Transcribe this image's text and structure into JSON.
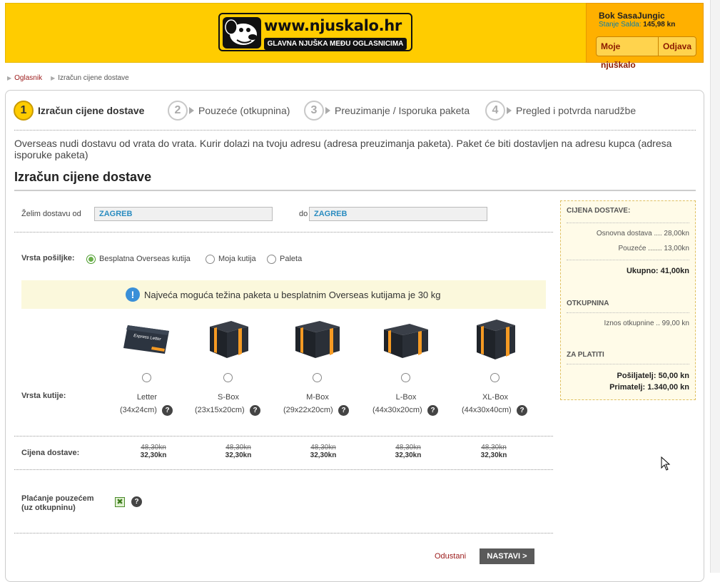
{
  "header": {
    "logo_url": "www.njuskalo.hr",
    "logo_slogan": "GLAVNA NJUŠKA MEĐU OGLASNICIMA",
    "greeting": "Bok SasaJungic",
    "saldo_label": "Stanje Salda:",
    "saldo_value": "145,98 kn",
    "btn_moje": "Moje njuškalo",
    "btn_odjava": "Odjava",
    "brand_color": "#ffcc00"
  },
  "breadcrumb": {
    "items": [
      "Oglasnik",
      "Izračun cijene dostave"
    ]
  },
  "steps": [
    {
      "num": "1",
      "label": "Izračun cijene dostave"
    },
    {
      "num": "2",
      "label": "Pouzeće (otkupnina)"
    },
    {
      "num": "3",
      "label": "Preuzimanje / Isporuka paketa"
    },
    {
      "num": "4",
      "label": "Pregled i potvrda narudžbe"
    }
  ],
  "intro": "Overseas nudi dostavu od vrata do vrata. Kurir dolazi na tvoju adresu (adresa preuzimanja paketa). Paket će biti dostavljen na adresu kupca (adresa isporuke paketa)",
  "title": "Izračun cijene dostave",
  "route": {
    "from_label": "Želim dostavu od",
    "from_value": "ZAGREB",
    "to_label": "do",
    "to_value": "ZAGREB"
  },
  "shipment": {
    "label": "Vrsta pošiljke:",
    "options": [
      "Besplatna Overseas kutija",
      "Moja kutija",
      "Paleta"
    ],
    "selected": "Besplatna Overseas kutija"
  },
  "notice": "Najveća moguća težina paketa u besplatnim Overseas kutijama je 30 kg",
  "boxes": {
    "label": "Vrsta kutije:",
    "items": [
      {
        "name": "Letter",
        "dims": "(34x24cm)",
        "old_price": "48,30kn",
        "new_price": "32,30kn"
      },
      {
        "name": "S-Box",
        "dims": "(23x15x20cm)",
        "old_price": "48,30kn",
        "new_price": "32,30kn"
      },
      {
        "name": "M-Box",
        "dims": "(29x22x20cm)",
        "old_price": "48,30kn",
        "new_price": "32,30kn"
      },
      {
        "name": "L-Box",
        "dims": "(44x30x20cm)",
        "old_price": "48,30kn",
        "new_price": "32,30kn"
      },
      {
        "name": "XL-Box",
        "dims": "(44x30x40cm)",
        "old_price": "48,30kn",
        "new_price": "32,30kn"
      }
    ],
    "box_label_letter": "Express Letter"
  },
  "price_label": "Cijena dostave:",
  "cod": {
    "label_line1": "Plaćanje pouzećem",
    "label_line2": "(uz otkupninu)",
    "checked": true
  },
  "actions": {
    "cancel": "Odustani",
    "next": "NASTAVI >"
  },
  "help_glyph": "?",
  "summary": {
    "cijena_title": "CIJENA DOSTAVE:",
    "osnovna": "Osnovna dostava .... 28,00kn",
    "pouzece": "Pouzeće ....... 13,00kn",
    "ukupno": "Ukupno: 41,00kn",
    "otkupnina_title": "OTKUPNINA",
    "iznos": "Iznos otkupnine .. 99,00 kn",
    "platiti_title": "ZA PLATITI",
    "posiljatelj": "Pošiljatelj: 50,00 kn",
    "primatelj": "Primatelj: 1.340,00 kn"
  }
}
